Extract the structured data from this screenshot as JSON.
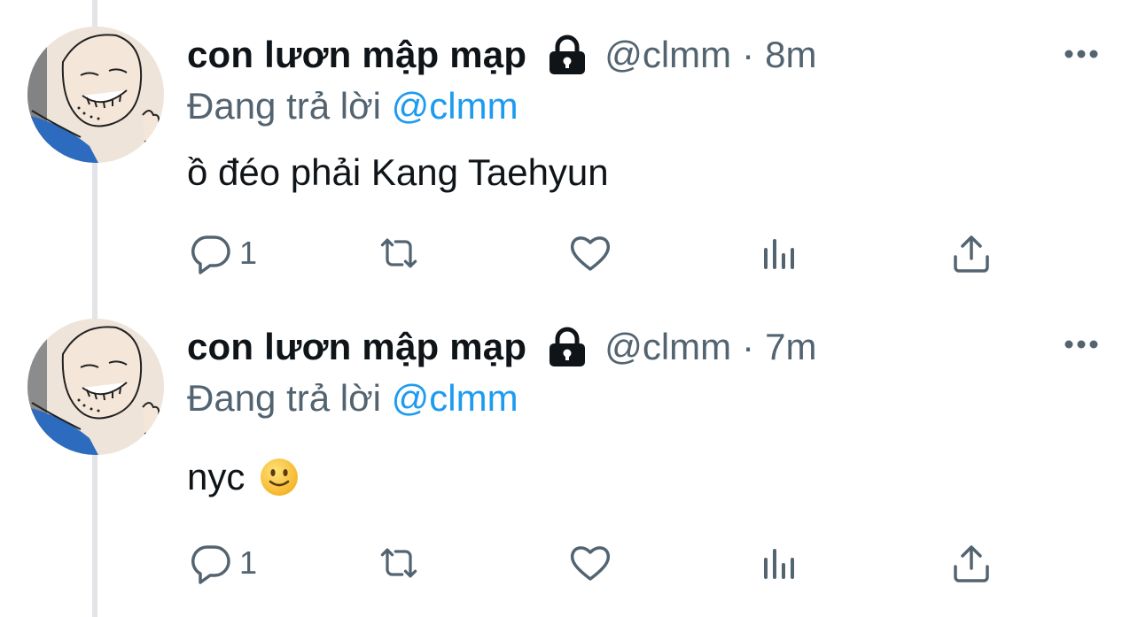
{
  "colors": {
    "text": "#0f1419",
    "secondary": "#536471",
    "accent": "#1d9bf0",
    "thread_line": "#e2e4e7"
  },
  "tweets": [
    {
      "display_name": "con lươn mập mạp",
      "handle": "@clmm",
      "separator": "·",
      "time": "8m",
      "replying_prefix": "Đang trả lời",
      "replying_to": "@clmm",
      "text": "ồ đéo phải Kang Taehyun",
      "has_emoji": false,
      "reply_count": "1",
      "icons": [
        "lock-icon",
        "more-icon",
        "reply-icon",
        "retweet-icon",
        "like-icon",
        "views-icon",
        "share-icon"
      ]
    },
    {
      "display_name": "con lươn mập mạp",
      "handle": "@clmm",
      "separator": "·",
      "time": "7m",
      "replying_prefix": "Đang trả lời",
      "replying_to": "@clmm",
      "text": "nyc",
      "has_emoji": true,
      "emoji": "slightly-smiling-face-emoji",
      "reply_count": "1",
      "icons": [
        "lock-icon",
        "more-icon",
        "reply-icon",
        "retweet-icon",
        "like-icon",
        "views-icon",
        "share-icon"
      ]
    }
  ]
}
